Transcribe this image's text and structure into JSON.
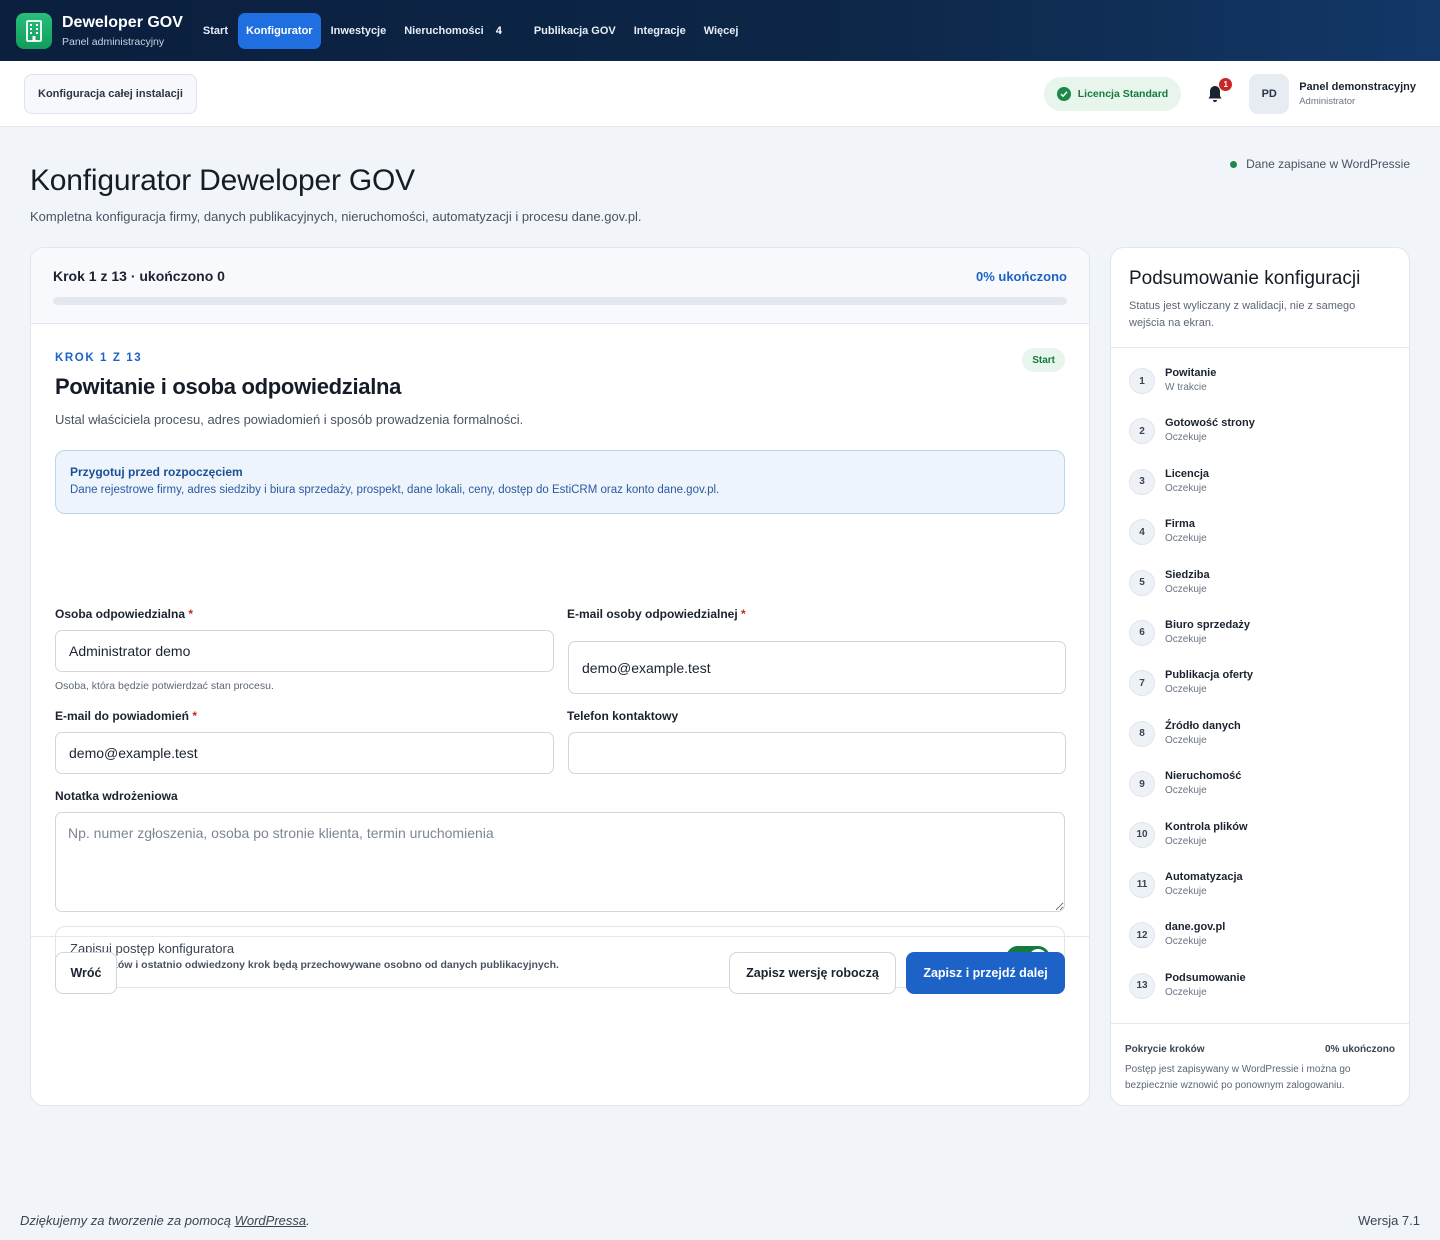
{
  "brand": {
    "title": "Deweloper GOV",
    "subtitle": "Panel administracyjny"
  },
  "nav": {
    "items": [
      {
        "label": "Start"
      },
      {
        "label": "Konfigurator",
        "active": true
      },
      {
        "label": "Inwestycje"
      },
      {
        "label": "Nieruchomości",
        "badge": "4"
      },
      {
        "label": "Publikacja GOV"
      },
      {
        "label": "Integracje"
      },
      {
        "label": "Więcej"
      }
    ]
  },
  "subbar": {
    "config_button": "Konfiguracja całej instalacji",
    "license": "Licencja Standard",
    "notifications_count": "1",
    "avatar_initials": "PD",
    "user_name": "Panel demonstracyjny",
    "user_role": "Administrator"
  },
  "page": {
    "saved_status": "Dane zapisane w WordPressie",
    "title": "Konfigurator Deweloper GOV",
    "description": "Kompletna konfiguracja firmy, danych publikacyjnych, nieruchomości, automatyzacji i procesu dane.gov.pl."
  },
  "wizard": {
    "step_count": "Krok 1 z 13 · ukończono 0",
    "percent_label": "0% ukończono",
    "progress": 0,
    "eyebrow": "KROK 1 Z 13",
    "start_badge": "Start",
    "title": "Powitanie i osoba odpowiedzialna",
    "description": "Ustal właściciela procesu, adres powiadomień i sposób prowadzenia formalności.",
    "info_title": "Przygotuj przed rozpoczęciem",
    "info_text": "Dane rejestrowe firmy, adres siedziby i biura sprzedaży, prospekt, dane lokali, ceny, dostęp do EstiCRM oraz konto dane.gov.pl.",
    "fields": {
      "responsible_label": "Osoba odpowiedzialna",
      "responsible_value": "Administrator demo",
      "responsible_hint": "Osoba, która będzie potwierdzać stan procesu.",
      "responsible_email_label": "E-mail osoby odpowiedzialnej",
      "responsible_email_value": "demo@example.test",
      "notify_email_label": "E-mail do powiadomień",
      "notify_email_value": "demo@example.test",
      "phone_label": "Telefon kontaktowy",
      "phone_value": "",
      "note_label": "Notatka wdrożeniowa",
      "note_placeholder": "Np. numer zgłoszenia, osoba po stronie klienta, termin uruchomienia",
      "required_mark": "*"
    },
    "toggle": {
      "title": "Zapisuj postęp konfiguratora",
      "subtitle": "Stan kroków i ostatnio odwiedzony krok będą przechowywane osobno od danych publikacyjnych.",
      "on": true
    },
    "buttons": {
      "back": "Wróć",
      "draft": "Zapisz wersję roboczą",
      "next": "Zapisz i przejdź dalej"
    }
  },
  "summary": {
    "title": "Podsumowanie konfiguracji",
    "description": "Status jest wyliczany z walidacji, nie z samego wejścia na ekran.",
    "steps": [
      {
        "num": "1",
        "name": "Powitanie",
        "status": "W trakcie"
      },
      {
        "num": "2",
        "name": "Gotowość strony",
        "status": "Oczekuje"
      },
      {
        "num": "3",
        "name": "Licencja",
        "status": "Oczekuje"
      },
      {
        "num": "4",
        "name": "Firma",
        "status": "Oczekuje"
      },
      {
        "num": "5",
        "name": "Siedziba",
        "status": "Oczekuje"
      },
      {
        "num": "6",
        "name": "Biuro sprzedaży",
        "status": "Oczekuje"
      },
      {
        "num": "7",
        "name": "Publikacja oferty",
        "status": "Oczekuje"
      },
      {
        "num": "8",
        "name": "Źródło danych",
        "status": "Oczekuje"
      },
      {
        "num": "9",
        "name": "Nieruchomość",
        "status": "Oczekuje"
      },
      {
        "num": "10",
        "name": "Kontrola plików",
        "status": "Oczekuje"
      },
      {
        "num": "11",
        "name": "Automatyzacja",
        "status": "Oczekuje"
      },
      {
        "num": "12",
        "name": "dane.gov.pl",
        "status": "Oczekuje"
      },
      {
        "num": "13",
        "name": "Podsumowanie",
        "status": "Oczekuje"
      }
    ],
    "coverage_label": "Pokrycie kroków",
    "coverage_value": "0% ukończono",
    "coverage_text": "Postęp jest zapisywany w WordPressie i można go bezpiecznie wznowić po ponownym zalogowaniu."
  },
  "footer": {
    "thanks_prefix": "Dziękujemy za tworzenie za pomocą ",
    "thanks_link": "WordPressa",
    "thanks_suffix": ".",
    "version": "Wersja 7.1"
  },
  "colors": {
    "accent": "#1d63c7",
    "success": "#157a3e",
    "danger": "#c62828",
    "nav_bg": "#0b1f3e"
  }
}
